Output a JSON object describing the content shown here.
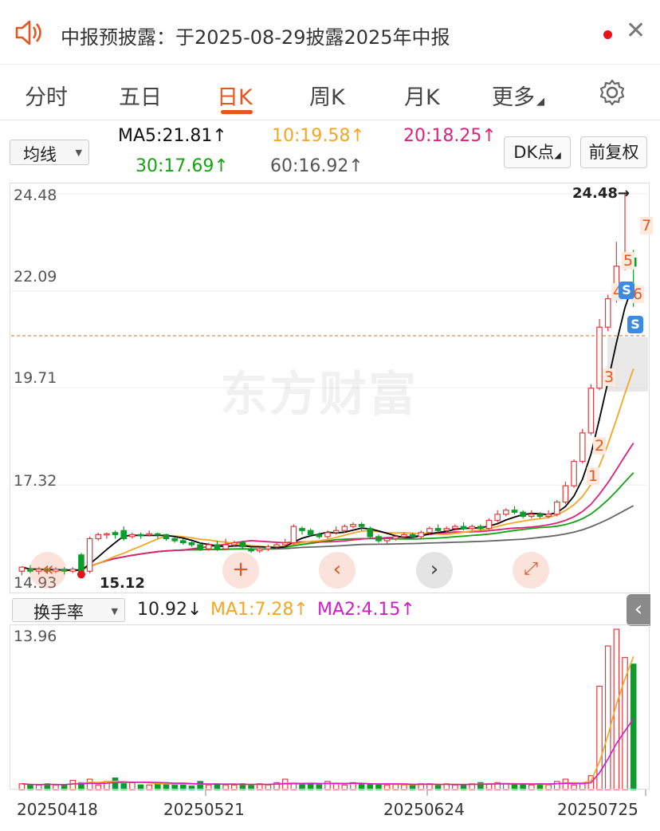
{
  "notice": {
    "text": "中报预披露：于2025-08-29披露2025年中报"
  },
  "tabs": [
    "分时",
    "五日",
    "日K",
    "周K",
    "月K",
    "更多"
  ],
  "active_tab": "日K",
  "indicator_bar": {
    "select": "均线",
    "ma5": "MA5:21.81↑",
    "ma10": "10:19.58↑",
    "ma20": "20:18.25↑",
    "ma30": "30:17.69↑",
    "ma60": "60:16.92↑",
    "dk_button": "DK点",
    "adjust_button": "前复权"
  },
  "price_axis": [
    "24.48",
    "22.09",
    "19.71",
    "17.32",
    "14.93"
  ],
  "peak_label": "24.48→",
  "low_label": "15.12",
  "watermark": "东方财富",
  "markers": [
    "1",
    "2",
    "3",
    "4",
    "5",
    "6",
    "7"
  ],
  "volume_bar": {
    "select": "换手率",
    "value": "10.92↓",
    "ma1": "MA1:7.28↑",
    "ma2": "MA2:4.15↑",
    "axis_top": "13.96"
  },
  "dates": [
    "20250418",
    "20250521",
    "20250624",
    "20250725"
  ],
  "colors": {
    "up": "#e23b3b",
    "down": "#0c9c2c",
    "accent": "#e4571e",
    "ma5": "#000000",
    "ma10": "#f5a623",
    "ma20": "#e0217a",
    "ma30": "#13a313",
    "ma60": "#666666"
  },
  "chart_data": {
    "type": "candlestick",
    "ylim": [
      14.93,
      24.48
    ],
    "candles": [
      [
        15.2,
        15.3,
        15.3,
        15.1
      ],
      [
        15.25,
        15.2,
        15.35,
        15.15
      ],
      [
        15.2,
        15.25,
        15.3,
        15.12
      ],
      [
        15.25,
        15.2,
        15.3,
        15.15
      ],
      [
        15.2,
        15.25,
        15.3,
        15.15
      ],
      [
        15.25,
        15.2,
        15.3,
        15.12
      ],
      [
        15.2,
        15.25,
        15.3,
        15.15
      ],
      [
        15.6,
        15.2,
        15.65,
        15.12
      ],
      [
        15.2,
        16.0,
        16.05,
        15.15
      ],
      [
        16.0,
        16.1,
        16.15,
        15.95
      ],
      [
        16.1,
        16.12,
        16.15,
        16.0
      ],
      [
        16.15,
        16.1,
        16.2,
        16.0
      ],
      [
        16.2,
        16.0,
        16.3,
        15.95
      ],
      [
        16.05,
        16.1,
        16.15,
        16.0
      ],
      [
        16.1,
        16.08,
        16.15,
        16.0
      ],
      [
        16.1,
        16.12,
        16.2,
        16.05
      ],
      [
        16.12,
        16.1,
        16.15,
        16.0
      ],
      [
        16.1,
        16.0,
        16.12,
        15.95
      ],
      [
        16.0,
        15.95,
        16.05,
        15.9
      ],
      [
        15.95,
        15.9,
        16.0,
        15.85
      ],
      [
        15.9,
        15.85,
        15.95,
        15.8
      ],
      [
        15.85,
        15.75,
        15.9,
        15.7
      ],
      [
        15.75,
        15.85,
        15.9,
        15.7
      ],
      [
        15.85,
        15.75,
        15.95,
        15.7
      ],
      [
        15.75,
        15.85,
        16.0,
        15.72
      ],
      [
        15.85,
        15.9,
        15.95,
        15.8
      ],
      [
        15.9,
        15.8,
        15.95,
        15.75
      ],
      [
        15.75,
        15.7,
        15.8,
        15.65
      ],
      [
        15.7,
        15.75,
        15.8,
        15.65
      ],
      [
        15.75,
        15.8,
        15.85,
        15.7
      ],
      [
        15.8,
        15.85,
        15.9,
        15.75
      ],
      [
        15.85,
        15.9,
        16.0,
        15.8
      ],
      [
        15.9,
        16.3,
        16.35,
        15.85
      ],
      [
        16.25,
        16.2,
        16.3,
        16.1
      ],
      [
        16.2,
        16.1,
        16.25,
        16.05
      ],
      [
        16.1,
        16.05,
        16.15,
        16.0
      ],
      [
        16.05,
        16.15,
        16.2,
        16.0
      ],
      [
        16.15,
        16.2,
        16.3,
        16.1
      ],
      [
        16.2,
        16.3,
        16.35,
        16.15
      ],
      [
        16.3,
        16.35,
        16.4,
        16.25
      ],
      [
        16.35,
        16.3,
        16.4,
        16.2
      ],
      [
        16.25,
        16.05,
        16.3,
        16.0
      ],
      [
        16.05,
        15.95,
        16.1,
        15.9
      ],
      [
        15.95,
        16.0,
        16.05,
        15.85
      ],
      [
        16.0,
        16.05,
        16.1,
        15.95
      ],
      [
        16.05,
        16.1,
        16.15,
        16.0
      ],
      [
        16.1,
        16.05,
        16.15,
        16.0
      ],
      [
        16.05,
        16.15,
        16.2,
        16.0
      ],
      [
        16.15,
        16.25,
        16.3,
        16.1
      ],
      [
        16.25,
        16.2,
        16.35,
        16.15
      ],
      [
        16.2,
        16.25,
        16.3,
        16.15
      ],
      [
        16.25,
        16.3,
        16.35,
        16.2
      ],
      [
        16.3,
        16.25,
        16.4,
        16.2
      ],
      [
        16.25,
        16.3,
        16.35,
        16.2
      ],
      [
        16.3,
        16.25,
        16.35,
        16.2
      ],
      [
        16.25,
        16.45,
        16.5,
        16.2
      ],
      [
        16.45,
        16.6,
        16.7,
        16.4
      ],
      [
        16.6,
        16.7,
        16.75,
        16.55
      ],
      [
        16.7,
        16.65,
        16.8,
        16.6
      ],
      [
        16.65,
        16.55,
        16.7,
        16.5
      ],
      [
        16.55,
        16.6,
        16.7,
        16.5
      ],
      [
        16.6,
        16.55,
        16.65,
        16.5
      ],
      [
        16.55,
        16.6,
        16.7,
        16.5
      ],
      [
        16.6,
        16.9,
        16.95,
        16.55
      ],
      [
        16.9,
        17.3,
        17.4,
        16.85
      ],
      [
        17.3,
        17.9,
        17.95,
        17.25
      ],
      [
        17.9,
        18.6,
        18.7,
        17.85
      ],
      [
        18.6,
        19.7,
        19.8,
        18.55
      ],
      [
        19.7,
        21.2,
        21.4,
        19.65
      ],
      [
        21.2,
        21.9,
        22.0,
        21.1
      ],
      [
        21.9,
        22.7,
        23.3,
        21.8
      ],
      [
        22.7,
        22.9,
        24.48,
        22.6
      ],
      [
        22.9,
        22.7,
        23.1,
        21.7
      ]
    ],
    "volume": [
      0.5,
      0.4,
      0.4,
      0.5,
      0.4,
      0.4,
      0.8,
      0.6,
      0.9,
      0.4,
      0.7,
      1.0,
      0.5,
      0.6,
      0.4,
      0.4,
      0.6,
      0.5,
      0.4,
      0.5,
      0.3,
      0.7,
      0.4,
      0.5,
      0.4,
      0.4,
      0.5,
      0.4,
      0.5,
      0.4,
      0.6,
      0.9,
      0.5,
      0.4,
      0.5,
      0.4,
      0.7,
      0.5,
      0.4,
      0.6,
      0.5,
      0.5,
      0.4,
      0.4,
      0.5,
      0.4,
      0.4,
      0.5,
      0.5,
      0.4,
      0.5,
      0.4,
      0.4,
      0.5,
      0.6,
      0.5,
      0.6,
      0.5,
      0.4,
      0.5,
      0.4,
      0.5,
      0.4,
      0.7,
      0.9,
      0.4,
      0.5,
      1.2,
      9.0,
      12.5,
      13.96,
      11.5,
      10.92
    ]
  }
}
